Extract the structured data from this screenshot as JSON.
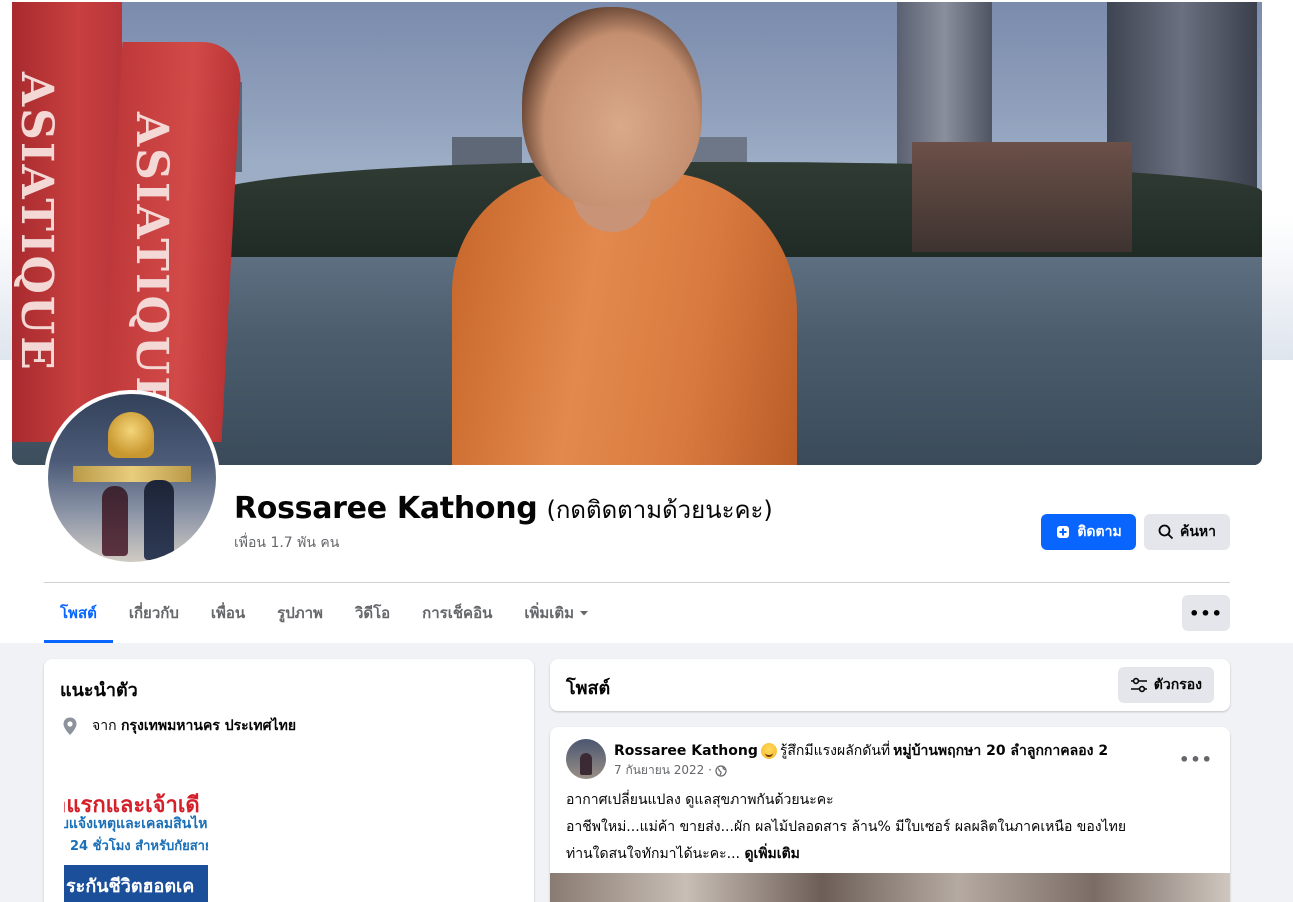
{
  "profile": {
    "name": "Rossaree Kathong",
    "name_suffix": "(กดติดตามด้วยนะคะ)",
    "friends": "เพื่อน 1.7 พัน คน",
    "follow_label": "ติดตาม",
    "search_label": "ค้นหา"
  },
  "cover": {
    "flag_text_1": "ASIATIQUE",
    "flag_text_2": "ASIATIQUE"
  },
  "tabs": [
    {
      "label": "โพสต์",
      "active": true
    },
    {
      "label": "เกี่ยวกับ"
    },
    {
      "label": "เพื่อน"
    },
    {
      "label": "รูปภาพ"
    },
    {
      "label": "วิดีโอ"
    },
    {
      "label": "การเช็คอิน"
    },
    {
      "label": "เพิ่มเติม"
    }
  ],
  "more_label": "•••",
  "intro": {
    "title": "แนะนำตัว",
    "location_prefix": "จาก",
    "location": "กรุงเทพมหานคร ประเทศไทย",
    "ad_line1": "าแรกและเจ้าเดี",
    "ad_line2": "บแจ้งเหตุและเคลมสินไหม",
    "ad_line3": "24 ชั่วโมง สำหรับกัยสาย",
    "ad_line4": "ระกันชีวิตฮอตเค"
  },
  "posts": {
    "title": "โพสต์",
    "filter_label": "ตัวกรอง"
  },
  "post": {
    "author": "Rossaree Kathong",
    "feeling": "รู้สึกมีแรงผลักดันที่",
    "place": "หมู่บ้านพฤกษา 20 ลำลูกกาคลอง 2",
    "date": "7 กันยายน 2022 ·",
    "line1": "อากาศเปลี่ยนแปลง  ดูแลสุขภาพกันด้วยนะคะ",
    "line2": "อาชีพใหม่...แม่ค้า ขายส่ง...ผัก ผลไม้ปลอดสาร ล้าน%  มีใบเซอร์  ผลผลิตในภาคเหนือ ของไทย",
    "line3": "ท่านใดสนใจทักมาได้นะคะ...",
    "see_more": "ดูเพิ่มเติม",
    "menu_label": "•••"
  },
  "colors": {
    "accent": "#0866ff",
    "button_gray": "#e4e6eb",
    "page_bg": "#f0f2f5",
    "secondary_text": "#65676b"
  }
}
